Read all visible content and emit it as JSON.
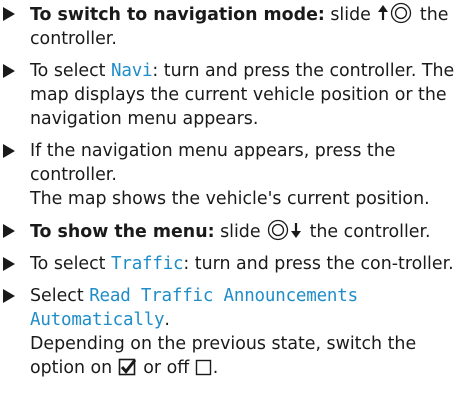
{
  "steps": [
    {
      "lead": "To switch to navigation mode:",
      "text_a": "slide",
      "icon": "controller-slide-up-icon",
      "text_b": "the controller."
    },
    {
      "text_a": "To select",
      "ui": "Navi",
      "text_b": ": turn and press the controller. The map displays the current vehicle position or the navigation menu appears."
    },
    {
      "text_a": "If the navigation menu appears, press the controller.",
      "text_b": "The map shows the vehicle's current position."
    },
    {
      "lead": "To show the menu:",
      "text_a": "slide",
      "icon": "controller-slide-down-icon",
      "text_b": "the controller."
    },
    {
      "text_a": "To select",
      "ui": "Traffic",
      "text_b": ": turn and press the con-troller."
    },
    {
      "text_a": "Select",
      "ui": "Read Traffic Announcements Automatically",
      "text_b": ".",
      "text_c": "Depending on the previous state, switch the option on",
      "icon_on": "checkbox-checked-icon",
      "text_d": "or off",
      "icon_off": "checkbox-empty-icon",
      "text_e": "."
    }
  ],
  "colors": {
    "text": "#1a1a1a",
    "ui_label": "#1f8dc8"
  }
}
